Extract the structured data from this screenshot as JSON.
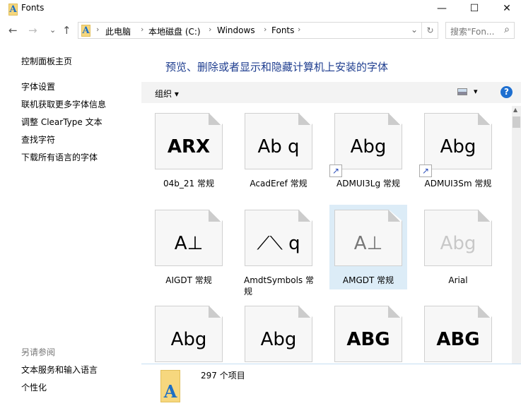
{
  "window": {
    "title": "Fonts",
    "minimize": "—",
    "maximize": "☐",
    "close": "✕"
  },
  "nav": {
    "back": "←",
    "forward": "→",
    "recent": "⌄",
    "up": "↑"
  },
  "address": {
    "crumbs": [
      "此电脑",
      "本地磁盘 (C:)",
      "Windows",
      "Fonts"
    ],
    "sep": "›",
    "dropdown": "⌄",
    "refresh": "↻"
  },
  "search": {
    "placeholder": "搜索\"Fon...",
    "icon": "⌕"
  },
  "sidebar": {
    "home": "控制面板主页",
    "links": [
      "字体设置",
      "联机获取更多字体信息",
      "调整 ClearType 文本",
      "查找字符",
      "下载所有语言的字体"
    ],
    "see_also_title": "另请参阅",
    "see_also": [
      "文本服务和输入语言",
      "个性化"
    ]
  },
  "heading": "预览、删除或者显示和隐藏计算机上安装的字体",
  "toolbar": {
    "organize": "组织 ▾",
    "view": "▾",
    "help": "?"
  },
  "fonts": [
    {
      "name": "04b_21 常规",
      "sample": "ARX"
    },
    {
      "name": "AcadEref 常规",
      "sample": "Ab q"
    },
    {
      "name": "ADMUI3Lg 常规",
      "sample": "Abg",
      "shortcut": true
    },
    {
      "name": "ADMUI3Sm 常规",
      "sample": "Abg",
      "shortcut": true
    },
    {
      "name": "AIGDT 常规",
      "sample": "A⊥"
    },
    {
      "name": "AmdtSymbols 常规",
      "sample": "⟋⟍ q"
    },
    {
      "name": "AMGDT 常规",
      "sample": "A⊥",
      "selected": true
    },
    {
      "name": "Arial",
      "sample": "Abg",
      "faded": true
    },
    {
      "name": "",
      "sample": "Abg"
    },
    {
      "name": "",
      "sample": "Abg"
    },
    {
      "name": "",
      "sample": "ABG"
    },
    {
      "name": "",
      "sample": "ABG"
    }
  ],
  "status": {
    "count": "297 个项目"
  }
}
